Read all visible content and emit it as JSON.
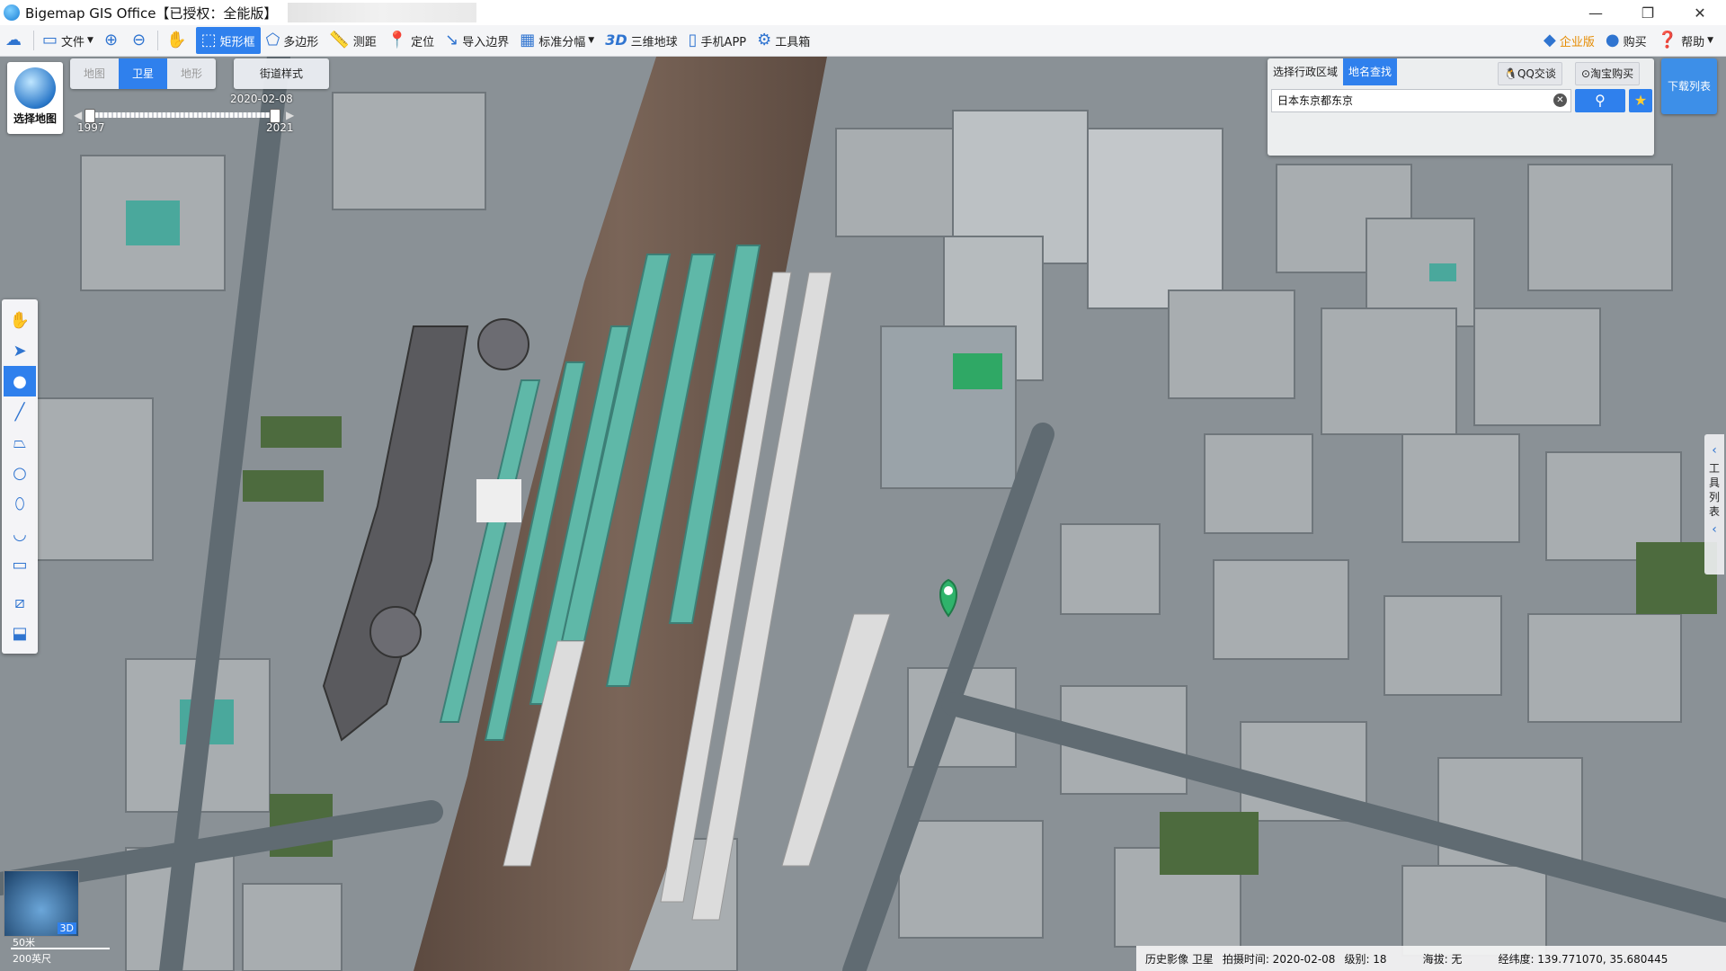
{
  "window": {
    "title": "Bigemap GIS Office【已授权：全能版】",
    "controls": [
      "—",
      "❐",
      "✕"
    ]
  },
  "toolbar": {
    "items": [
      {
        "label": "文件",
        "icon": "folder-icon"
      },
      {
        "label": "",
        "icon": "zoom-in-icon"
      },
      {
        "label": "",
        "icon": "zoom-out-icon"
      },
      {
        "label": "",
        "icon": "pan-hand-icon"
      },
      {
        "label": "矩形框",
        "icon": "rectangle-select-icon",
        "active": true
      },
      {
        "label": "多边形",
        "icon": "polygon-icon"
      },
      {
        "label": "测距",
        "icon": "ruler-icon"
      },
      {
        "label": "定位",
        "icon": "location-pin-icon"
      },
      {
        "label": "导入边界",
        "icon": "import-boundary-icon"
      },
      {
        "label": "标准分幅",
        "icon": "grid-icon"
      },
      {
        "label": "三维地球",
        "icon": "3d-icon"
      },
      {
        "label": "手机APP",
        "icon": "phone-icon"
      },
      {
        "label": "工具箱",
        "icon": "gear-icon"
      }
    ],
    "right": {
      "enterprise": "企业版",
      "buy": "购买",
      "help": "帮助"
    }
  },
  "map": {
    "select_map_label": "选择地图",
    "layer_tabs": [
      "地图",
      "卫星",
      "地形"
    ],
    "selected_layer": "卫星",
    "street_style": "街道样式",
    "timeline": {
      "date": "2020-02-08",
      "start_year": "1997",
      "end_year": "2021"
    },
    "overview_badge": "3D",
    "scale": {
      "metric": "50米",
      "imperial": "200英尺"
    }
  },
  "search": {
    "tabs": [
      "选择行政区域",
      "地名查找"
    ],
    "selected_tab": "地名查找",
    "qq_label": "QQ交谈",
    "taobao_label": "淘宝购买",
    "query": "日本东京都东京",
    "download_list": "下载列表"
  },
  "side_panel": {
    "label_chars": [
      "工",
      "具",
      "列",
      "表"
    ]
  },
  "status": {
    "imagery": "历史影像 卫星",
    "capture": "拍摄时间: 2020-02-08",
    "level": "级别:  18",
    "altitude": "海拔: 无",
    "coords": "经纬度:    139.771070, 35.680445"
  },
  "colors": {
    "accent": "#2f80ed",
    "enterprise": "#e58b00",
    "marker": "#2fb36b"
  }
}
